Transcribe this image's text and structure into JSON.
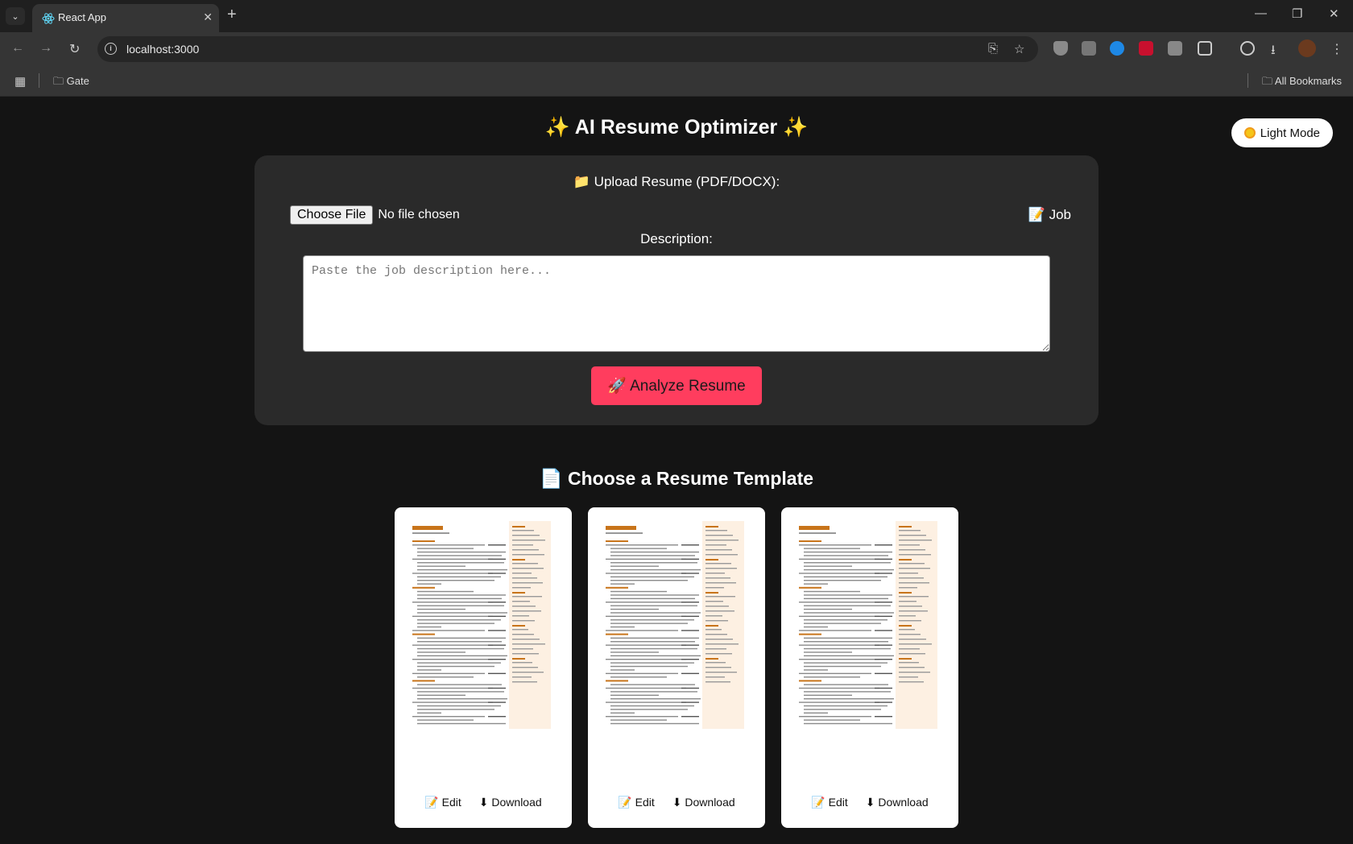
{
  "browser": {
    "tab_title": "React App",
    "url": "localhost:3000",
    "bookmark_folder": "Gate",
    "all_bookmarks": "All Bookmarks"
  },
  "header": {
    "title": "✨ AI Resume Optimizer ✨",
    "theme_toggle_label": "Light Mode"
  },
  "upload": {
    "label": "📁 Upload Resume (PDF/DOCX):",
    "choose_file": "Choose File",
    "no_file": "No file chosen",
    "job_label_part1": "📝 Job",
    "job_label_part2": "Description:",
    "placeholder": "Paste the job description here...",
    "analyze_label": "🚀 Analyze Resume"
  },
  "templates": {
    "title": "📄 Choose a Resume Template",
    "cards": [
      {
        "edit_label": "📝 Edit",
        "download_label": "⬇ Download"
      },
      {
        "edit_label": "📝 Edit",
        "download_label": "⬇ Download"
      },
      {
        "edit_label": "📝 Edit",
        "download_label": "⬇ Download"
      }
    ]
  },
  "colors": {
    "page_bg": "#141414",
    "panel_bg": "#2a2a2a",
    "accent": "#ff3d5e",
    "resume_accent": "#c8741a"
  }
}
